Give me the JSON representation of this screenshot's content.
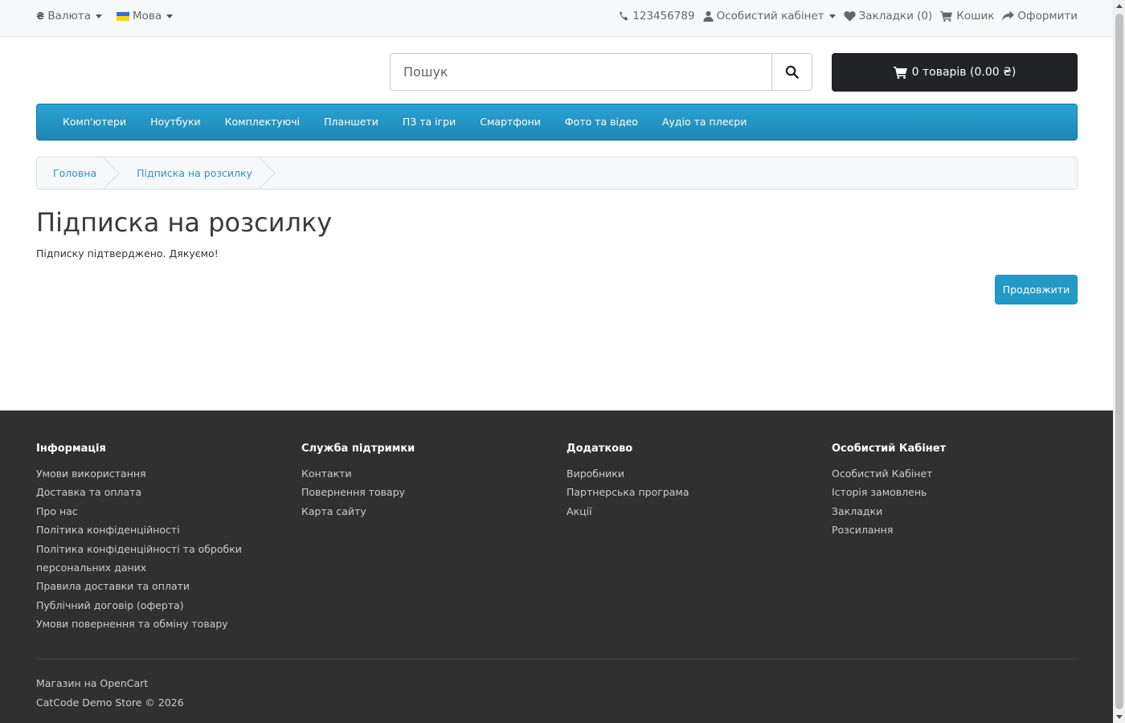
{
  "topbar": {
    "currency": {
      "symbol": "₴",
      "label": "Валюта"
    },
    "language": {
      "label": "Мова"
    },
    "phone": "123456789",
    "account": "Особистий кабінет",
    "wishlist": "Закладки (0)",
    "cart": "Кошик",
    "checkout": "Оформити"
  },
  "header": {
    "search_placeholder": "Пошук",
    "cart_button": "0 товарів (0.00 ₴)"
  },
  "menu": {
    "items": [
      "Комп'ютери",
      "Ноутбуки",
      "Комплектуючі",
      "Планшети",
      "ПЗ та ігри",
      "Смартфони",
      "Фото та відео",
      "Аудіо та плеєри"
    ]
  },
  "breadcrumb": [
    "Головна",
    "Підписка на розсилку"
  ],
  "content": {
    "title": "Підписка на розсилку",
    "message": "Підписку підтверджено. Дякуємо!",
    "continue_button": "Продовжити"
  },
  "footer": {
    "columns": [
      {
        "title": "Інформація",
        "links": [
          "Умови використання",
          "Доставка та оплата",
          "Про нас",
          "Політика конфіденційності",
          "Політика конфіденційності та обробки",
          "персональних даних",
          "Правила доставки та оплати",
          "Публічний договір (оферта)",
          "Умови повернення та обміну товару"
        ]
      },
      {
        "title": "Служба підтримки",
        "links": [
          "Контакти",
          "Повернення товару",
          "Карта сайту"
        ]
      },
      {
        "title": "Додатково",
        "links": [
          "Виробники",
          "Партнерська програма",
          "Акції"
        ]
      },
      {
        "title": "Особистий Кабінет",
        "links": [
          "Особистий Кабінет",
          "Історія замовлень",
          "Закладки",
          "Розсилання"
        ]
      }
    ],
    "powered_prefix": "Магазин на ",
    "powered_link": "OpenCart",
    "copyright": "CatCode Demo Store © 2026"
  },
  "colors": {
    "accent": "#229ac8",
    "menu": "#1f90c4",
    "dark": "#222326",
    "footer": "#303030"
  }
}
